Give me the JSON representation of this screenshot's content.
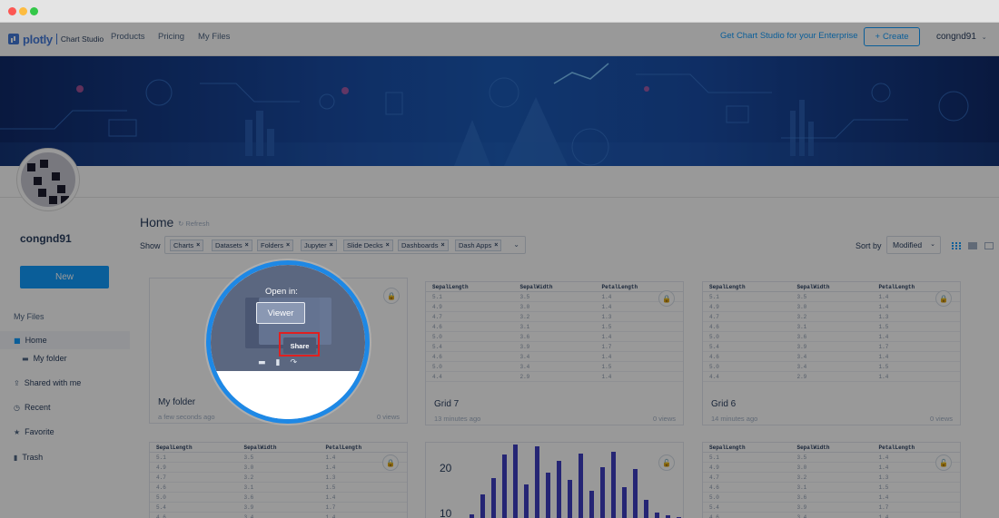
{
  "nav": {
    "brand": "plotly",
    "brand_sub": "Chart Studio",
    "links": [
      "Products",
      "Pricing",
      "My Files"
    ],
    "enterprise": "Get Chart Studio for your Enterprise",
    "create": "Create",
    "user": "congnd91"
  },
  "profile": {
    "username": "congnd91",
    "new_button": "New"
  },
  "sidebar": {
    "heading": "My Files",
    "items": [
      "Home",
      "My folder",
      "Shared with me",
      "Recent",
      "Favorite",
      "Trash"
    ]
  },
  "main": {
    "title": "Home",
    "refresh": "Refresh",
    "show_label": "Show",
    "filters": [
      "Charts",
      "Datasets",
      "Folders",
      "Jupyter",
      "Slide Decks",
      "Dashboards",
      "Dash Apps"
    ],
    "sort_label": "Sort by",
    "sort_value": "Modified"
  },
  "grid_headers": [
    "SepalLength",
    "SepalWidth",
    "PetalLength"
  ],
  "grid_rows": [
    [
      "5.1",
      "3.5",
      "1.4"
    ],
    [
      "4.9",
      "3.0",
      "1.4"
    ],
    [
      "4.7",
      "3.2",
      "1.3"
    ],
    [
      "4.6",
      "3.1",
      "1.5"
    ],
    [
      "5.0",
      "3.6",
      "1.4"
    ],
    [
      "5.4",
      "3.9",
      "1.7"
    ],
    [
      "4.6",
      "3.4",
      "1.4"
    ],
    [
      "5.0",
      "3.4",
      "1.5"
    ],
    [
      "4.4",
      "2.9",
      "1.4"
    ]
  ],
  "cards": [
    {
      "title": "My folder",
      "time": "a few seconds ago",
      "views": "0 views"
    },
    {
      "title": "Grid 7",
      "time": "13 minutes ago",
      "views": "0 views"
    },
    {
      "title": "Grid 6",
      "time": "14 minutes ago",
      "views": "0 views"
    }
  ],
  "folder_menu": {
    "open_in": "Open in:",
    "viewer": "Viewer",
    "share": "Share"
  },
  "histogram": {
    "y_ticks": [
      "20",
      "10"
    ],
    "bar_heights": [
      0.06,
      0.33,
      0.55,
      0.86,
      1.0,
      0.46,
      0.97,
      0.62,
      0.78,
      0.52,
      0.88,
      0.38,
      0.7,
      0.9,
      0.43,
      0.67,
      0.25,
      0.08,
      0.05,
      0.03,
      0.2
    ]
  },
  "colors": {
    "accent": "#119dff",
    "brand": "#447adb",
    "magnifier_ring": "#1e88e5",
    "highlight": "#e02020",
    "bars": "#3f3fc2"
  }
}
